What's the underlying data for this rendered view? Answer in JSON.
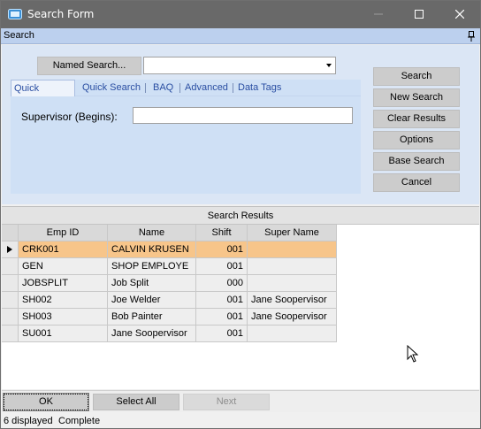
{
  "window": {
    "title": "Search Form",
    "title_bar_color": "#696969"
  },
  "panel": {
    "label": "Search"
  },
  "named_search": {
    "button_label": "Named Search...",
    "combo_value": ""
  },
  "tabs": [
    {
      "label": "Quick Search",
      "active": true
    },
    {
      "label": "Quick Search",
      "active": false
    },
    {
      "label": "BAQ",
      "active": false
    },
    {
      "label": "Advanced",
      "active": false
    },
    {
      "label": "Data Tags",
      "active": false
    }
  ],
  "quick_search": {
    "field_label": "Supervisor (Begins):",
    "field_value": ""
  },
  "actions": {
    "search": "Search",
    "new_search": "New Search",
    "clear_results": "Clear Results",
    "options": "Options",
    "base_search": "Base Search",
    "cancel": "Cancel"
  },
  "results": {
    "title": "Search Results",
    "columns": [
      "Emp ID",
      "Name",
      "Shift",
      "Super Name"
    ],
    "rows": [
      {
        "emp_id": "CRK001",
        "name": "CALVIN KRUSEN",
        "shift": "001",
        "super_name": "",
        "selected": true
      },
      {
        "emp_id": "GEN",
        "name": "SHOP EMPLOYE",
        "shift": "001",
        "super_name": "",
        "selected": false
      },
      {
        "emp_id": "JOBSPLIT",
        "name": "Job Split",
        "shift": "000",
        "super_name": "",
        "selected": false
      },
      {
        "emp_id": "SH002",
        "name": "Joe Welder",
        "shift": "001",
        "super_name": "Jane Soopervisor",
        "selected": false
      },
      {
        "emp_id": "SH003",
        "name": "Bob Painter",
        "shift": "001",
        "super_name": "Jane Soopervisor",
        "selected": false
      },
      {
        "emp_id": "SU001",
        "name": "Jane Soopervisor",
        "shift": "001",
        "super_name": "",
        "selected": false
      }
    ],
    "selected_row_color": "#f7c58a"
  },
  "bottom": {
    "ok": "OK",
    "select_all": "Select All",
    "next": "Next"
  },
  "status": {
    "count": "6 displayed",
    "state": "Complete"
  }
}
